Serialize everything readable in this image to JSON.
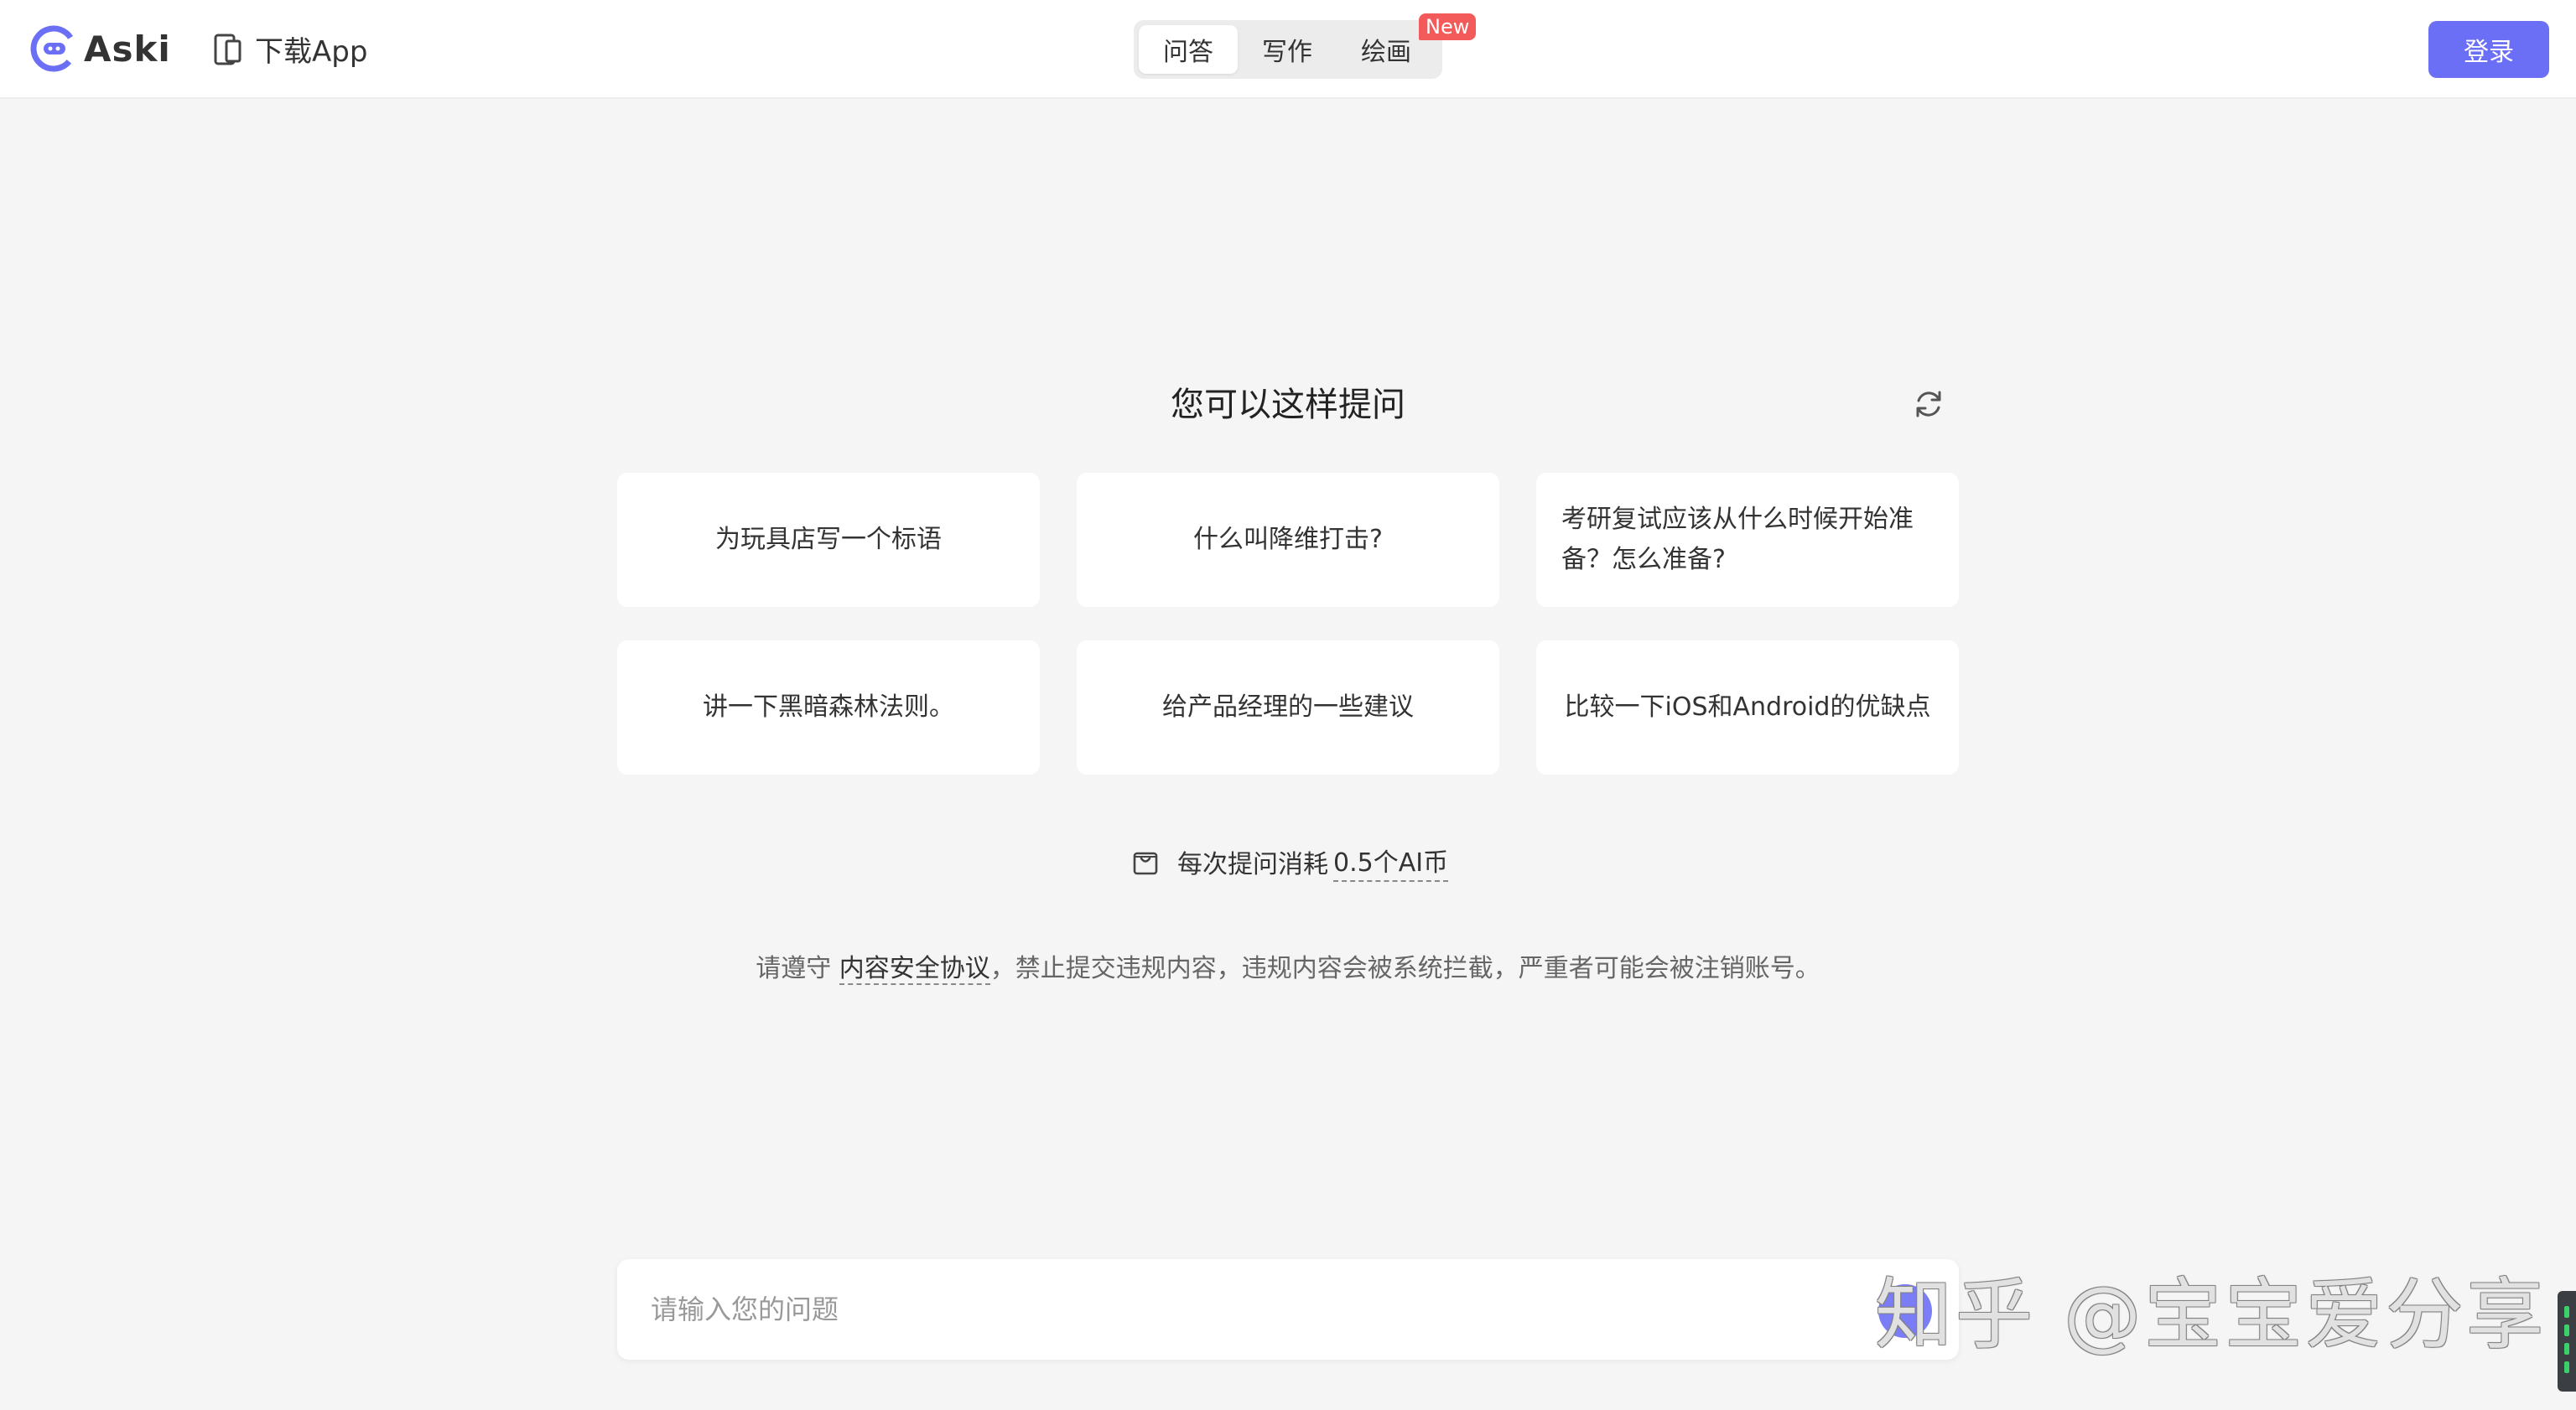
{
  "header": {
    "logo_text": "Aski",
    "download_label": "下载App",
    "tabs": [
      {
        "label": "问答",
        "active": true
      },
      {
        "label": "写作",
        "active": false
      },
      {
        "label": "绘画",
        "active": false
      }
    ],
    "new_badge": "New",
    "login_label": "登录"
  },
  "colors": {
    "accent": "#6b6ff5",
    "badge": "#f35b5b",
    "background": "#f5f5f5"
  },
  "suggestions": {
    "title": "您可以这样提问",
    "refresh_icon": "refresh-icon",
    "items": [
      "为玩具店写一个标语",
      "什么叫降维打击?",
      "考研复试应该从什么时候开始准备？怎么准备?",
      "讲一下黑暗森林法则。",
      "给产品经理的一些建议",
      "比较一下iOS和Android的优缺点"
    ]
  },
  "cost": {
    "prefix": "每次提问消耗",
    "link": "0.5个AI币"
  },
  "notice": {
    "before": "请遵守",
    "link": "内容安全协议",
    "after": "，禁止提交违规内容，违规内容会被系统拦截，严重者可能会被注销账号。"
  },
  "input": {
    "placeholder": "请输入您的问题",
    "value": ""
  },
  "watermark": "知乎 @宝宝爱分享"
}
